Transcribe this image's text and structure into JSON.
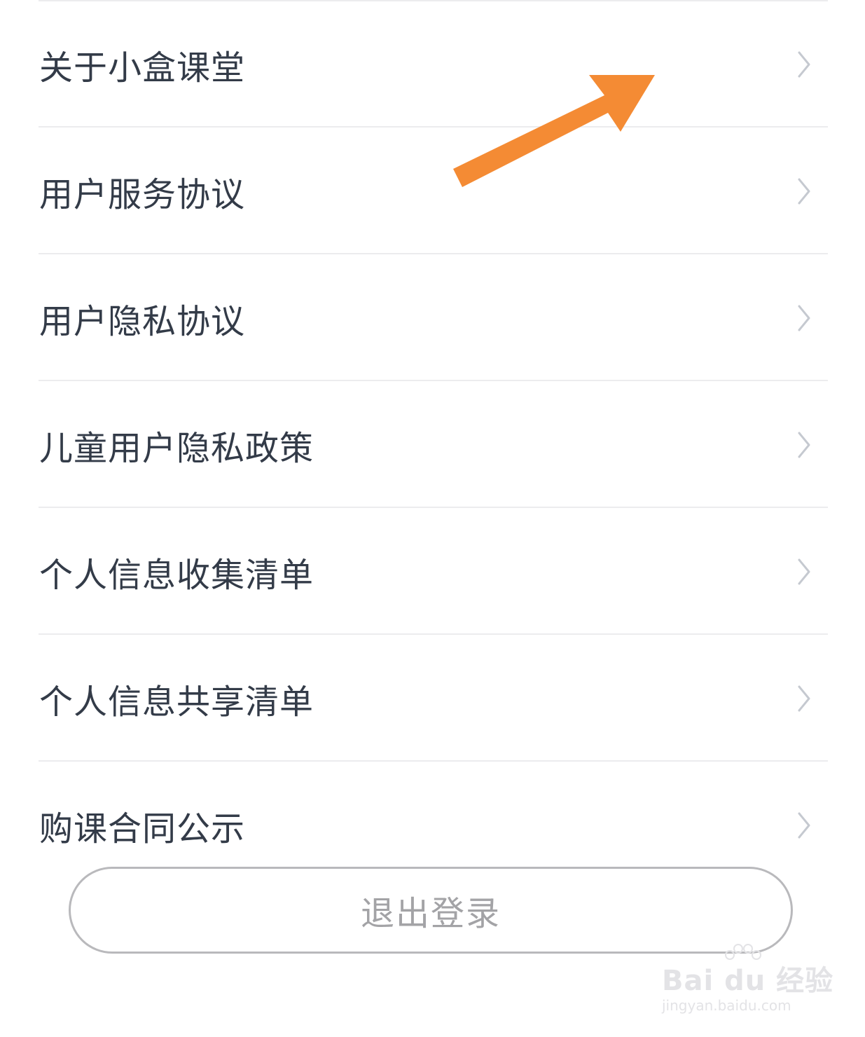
{
  "menu": {
    "items": [
      {
        "label": "关于小盒课堂",
        "icon": "chevron-right-icon"
      },
      {
        "label": "用户服务协议",
        "icon": "chevron-right-icon"
      },
      {
        "label": "用户隐私协议",
        "icon": "chevron-right-icon"
      },
      {
        "label": "儿童用户隐私政策",
        "icon": "chevron-right-icon"
      },
      {
        "label": "个人信息收集清单",
        "icon": "chevron-right-icon"
      },
      {
        "label": "个人信息共享清单",
        "icon": "chevron-right-icon"
      },
      {
        "label": "购课合同公示",
        "icon": "chevron-right-icon"
      }
    ]
  },
  "logout": {
    "label": "退出登录"
  },
  "annotation": {
    "icon": "arrow-annotation-icon",
    "color": "#f48b34"
  },
  "watermark": {
    "brand": "Bai du 经验",
    "url": "jingyan.baidu.com"
  },
  "colors": {
    "text": "#333b48",
    "chevron": "#c5c9d0",
    "divider": "#ececee",
    "logout_text": "#a3a3a6",
    "logout_border": "#b9b9bc"
  }
}
